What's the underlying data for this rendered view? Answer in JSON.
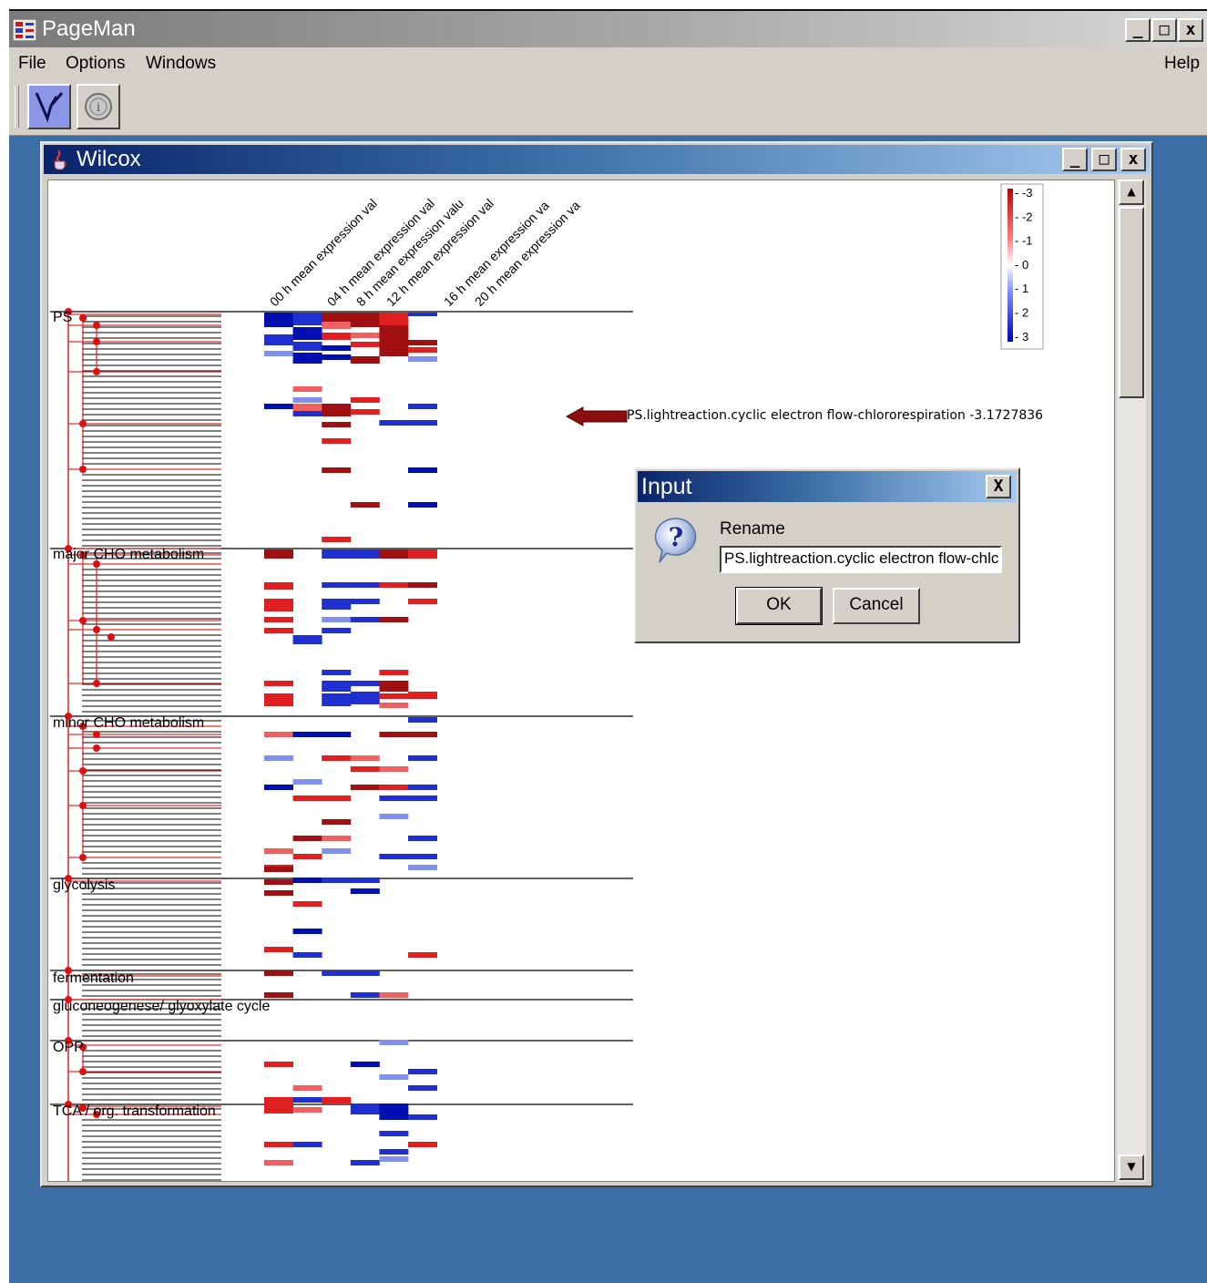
{
  "app": {
    "title": "PageMan",
    "menu": [
      "File",
      "Options",
      "Windows"
    ],
    "help": "Help",
    "toolbar": [
      {
        "icon": "tree-icon"
      },
      {
        "icon": "info-icon"
      }
    ]
  },
  "window_controls": {
    "minimize": "_",
    "maximize": "□",
    "close": "x"
  },
  "window": {
    "title": "Wilcox"
  },
  "heatmap": {
    "columns": [
      "00 h mean expression val",
      "04 h mean expression val",
      "8 h mean expression valu",
      "12 h mean expression val",
      "16 h mean expression va",
      "20 h mean expression va"
    ],
    "categories": [
      "PS",
      "major CHO metabolism",
      "minor CHO metabolism",
      "glycolysis",
      "fermentation",
      "gluconeogenese/ glyoxylate cycle",
      "OPP",
      "TCA / org. transformation"
    ],
    "legend": [
      "-3",
      "-2",
      "-1",
      "0",
      "1",
      "2",
      "3"
    ],
    "colors": {
      "red_strong": "#a01010",
      "red": "#e02020",
      "red_light": "#f06060",
      "blue_strong": "#0010b0",
      "blue": "#2030d0",
      "blue_light": "#8090f0"
    },
    "annotation": "PS.lightreaction.cyclic electron flow-chlororespiration -3.1727836"
  },
  "dialog": {
    "title": "Input",
    "close": "X",
    "icon": "question-icon",
    "label": "Rename",
    "value": "PS.lightreaction.cyclic electron flow-chlc",
    "ok": "OK",
    "cancel": "Cancel"
  },
  "scrollbar": {
    "up": "▲",
    "down": "▼"
  }
}
